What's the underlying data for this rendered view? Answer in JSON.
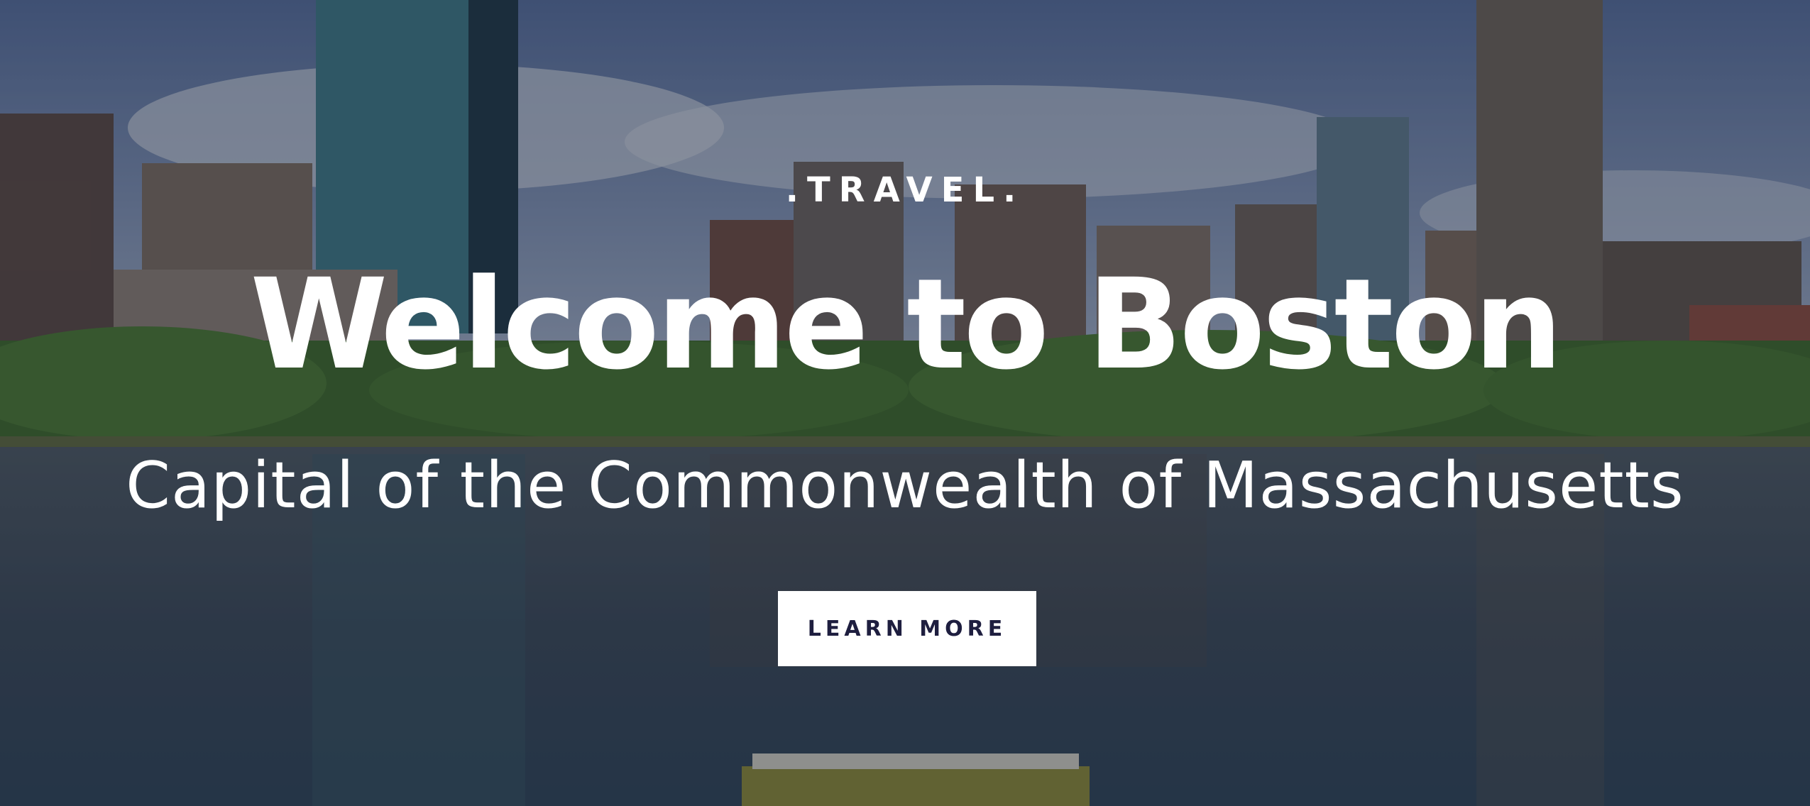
{
  "hero": {
    "eyebrow": ".TRAVEL.",
    "title": "Welcome to Boston",
    "subtitle": "Capital of the Commonwealth of Massachusetts",
    "cta_label": "LEARN MORE"
  },
  "colors": {
    "sky": "#4f6a98",
    "water": "#3a4c5e",
    "trees": "#3e6b2c",
    "button_bg": "#ffffff",
    "button_text": "#1e1e3f"
  },
  "background": {
    "scene": "boston-skyline-charles-river"
  }
}
